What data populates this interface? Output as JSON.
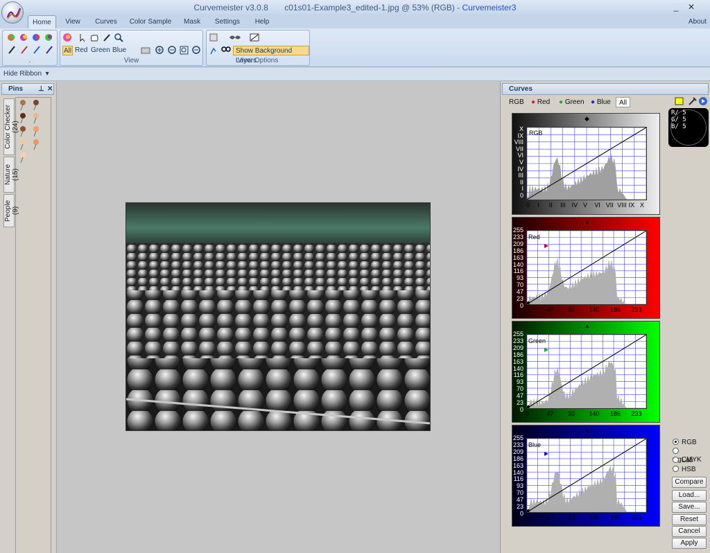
{
  "window": {
    "title_app": "Curvemeister v3.0.8",
    "title_file": "c01s01-Example3_edited-1.jpg @ 53% (RGB) -",
    "title_link": "Curvemeister3",
    "minimize": "_",
    "close": "✕"
  },
  "menu": {
    "tabs": [
      "Home",
      "View",
      "Curves",
      "Color Sample",
      "Mask",
      "Settings",
      "Help"
    ],
    "about": "About"
  },
  "ribbon": {
    "group1_label": ".",
    "view_group_label": "View",
    "view_options_label": "View Options",
    "channel_buttons": [
      "All",
      "Red",
      "Green",
      "Blue"
    ],
    "show_background_layers": "Show Background Layers"
  },
  "hide_ribbon": "Hide Ribbon",
  "pins": {
    "title": "Pins",
    "tabs": [
      "Color Checker (24)",
      "Nature (15)",
      "People (9)"
    ]
  },
  "curves": {
    "title": "Curves",
    "tabs": [
      "RGB",
      "Red",
      "Green",
      "Blue",
      "All"
    ],
    "readout": [
      "R/ 5",
      "G/ 5",
      "B/ 5"
    ],
    "rgb_graph": {
      "label": "RGB",
      "y_ticks": [
        "X",
        "IX",
        "VIII",
        "VII",
        "VI",
        "V",
        "IV",
        "III",
        "II",
        "I",
        "0"
      ],
      "x_ticks": [
        "0",
        "I",
        "II",
        "III",
        "IV",
        "V",
        "VI",
        "VII",
        "VIII",
        "IX",
        "X"
      ]
    },
    "channel_graphs": [
      {
        "label": "Red",
        "color": "#dd0000"
      },
      {
        "label": "Green",
        "color": "#00bb00"
      },
      {
        "label": "Blue",
        "color": "#1010cc"
      }
    ],
    "y_ticks": [
      "255",
      "233",
      "209",
      "186",
      "163",
      "140",
      "116",
      "93",
      "70",
      "47",
      "23",
      "0"
    ],
    "x_ticks": [
      "0",
      "47",
      "93",
      "140",
      "186",
      "233"
    ],
    "modes": [
      "RGB",
      "wgCMYK",
      "Lab",
      "HSB"
    ],
    "selected_mode": "RGB",
    "buttons": [
      "Compare",
      "Load...",
      "Save...",
      "Reset",
      "Cancel",
      "Apply"
    ]
  }
}
